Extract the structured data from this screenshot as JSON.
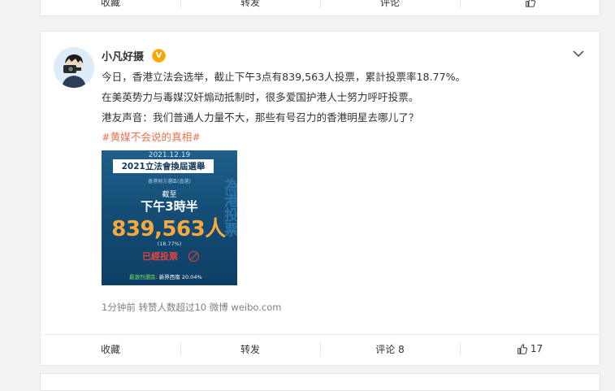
{
  "top_card": {
    "actions": {
      "collect": "收藏",
      "repost": "转发",
      "comment": "评论",
      "like": ""
    }
  },
  "post": {
    "author": "小凡好摄",
    "verified_badge": "V",
    "text": {
      "line1": "今日，香港立法会选举，截止下午3点有839,563人投票，累計投票率18.77%。",
      "line2": "在美英势力与毒媒汉奸煽动抵制时，很多爱国护港人士努力呼吁投票。",
      "line3": "港友声音：我们普通人力量不大，那些有号召力的香港明星去哪儿了？",
      "hashtag": "#黄媒不会说的真相#"
    },
    "image": {
      "date": "2021.12.19",
      "title": "2021立法會換屆選舉",
      "subtitle": "香港地方選區(直選)",
      "as_of": "截至",
      "time": "下午3時半",
      "count": "839,563人",
      "percent": "(18.77%)",
      "voted": "已經投票",
      "footer_label": "最激烈選區:",
      "footer_value": "新界西南 20.04%",
      "deco": "為港投票"
    },
    "meta": "1分钟前 转赞人数超过10 微博 weibo.com",
    "actions": {
      "collect": "收藏",
      "repost": "转发",
      "comment": "评论 8",
      "like": "17"
    }
  },
  "colors": {
    "hashtag": "#eb7350",
    "badge": "#f8a600",
    "meta": "#808080"
  }
}
